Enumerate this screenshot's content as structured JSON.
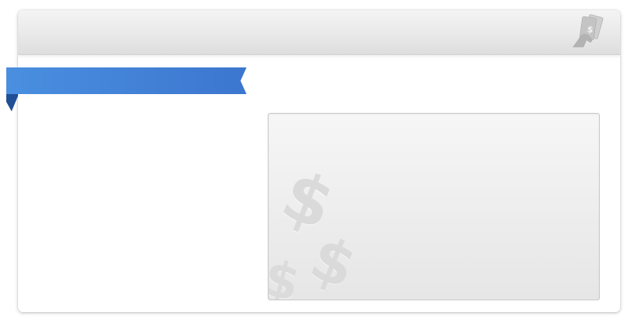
{
  "window": {
    "header": {
      "icon": "money-in-hand-icon"
    },
    "ribbon": {
      "color": "#4a8fe0",
      "fold_color": "#1f4f96"
    },
    "panel": {
      "decor_icons": [
        "dollar-sign-icon",
        "dollar-sign-icon",
        "dollar-sign-icon"
      ]
    }
  },
  "colors": {
    "accent": "#4a8fe0",
    "panel_bg": "#ececec",
    "header_bg": "#e9e9e9"
  }
}
